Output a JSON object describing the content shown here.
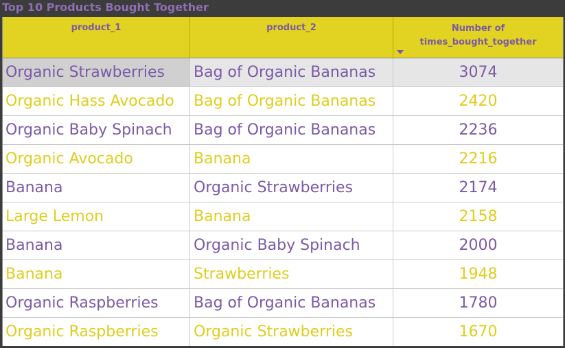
{
  "title": "Top 10 Products Bought Together",
  "columns": {
    "product_1": "product_1",
    "product_2": "product_2",
    "count_line1": "Number of",
    "count_line2": "times_bought_together"
  },
  "colors": {
    "header_bg": "#e2d221",
    "purple_text": "#7b5aa6",
    "yellow_text": "#e0cd1e"
  },
  "rows": [
    {
      "product_1": "Organic Strawberries",
      "product_2": "Bag of Organic Bananas",
      "count": "3074"
    },
    {
      "product_1": "Organic Hass Avocado",
      "product_2": "Bag of Organic Bananas",
      "count": "2420"
    },
    {
      "product_1": "Organic Baby Spinach",
      "product_2": "Bag of Organic Bananas",
      "count": "2236"
    },
    {
      "product_1": "Organic Avocado",
      "product_2": "Banana",
      "count": "2216"
    },
    {
      "product_1": "Banana",
      "product_2": "Organic Strawberries",
      "count": "2174"
    },
    {
      "product_1": "Large Lemon",
      "product_2": "Banana",
      "count": "2158"
    },
    {
      "product_1": "Banana",
      "product_2": "Organic Baby Spinach",
      "count": "2000"
    },
    {
      "product_1": "Banana",
      "product_2": "Strawberries",
      "count": "1948"
    },
    {
      "product_1": "Organic Raspberries",
      "product_2": "Bag of Organic Bananas",
      "count": "1780"
    },
    {
      "product_1": "Organic Raspberries",
      "product_2": "Organic Strawberries",
      "count": "1670"
    }
  ]
}
